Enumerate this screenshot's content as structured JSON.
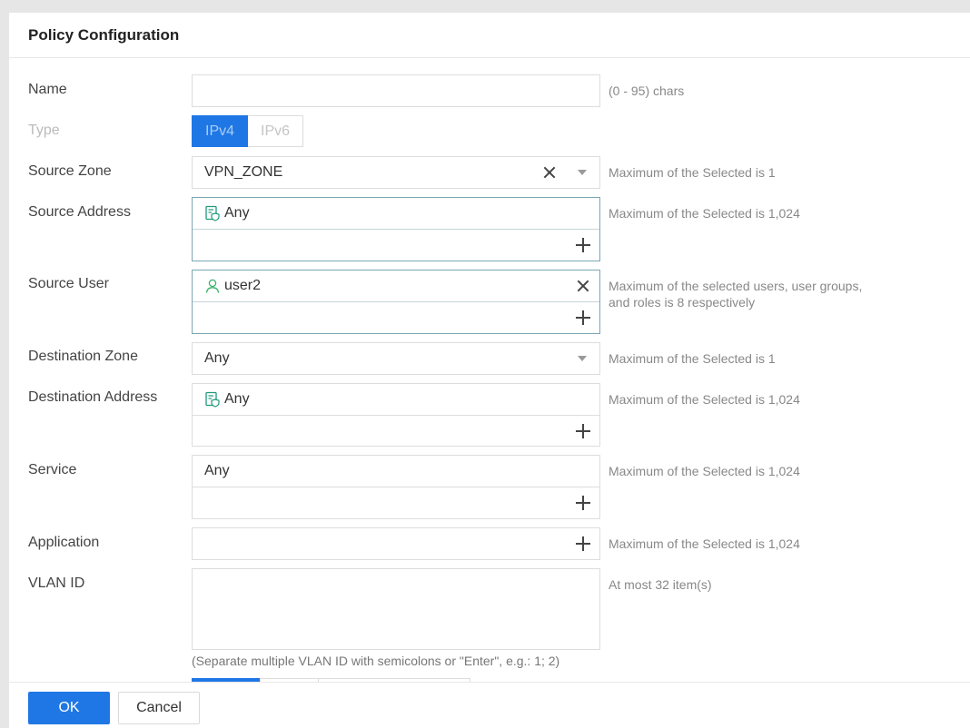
{
  "dialog": {
    "title": "Policy Configuration"
  },
  "name": {
    "label": "Name",
    "value": "",
    "hint": "(0 - 95) chars"
  },
  "type": {
    "label": "Type",
    "options": [
      "IPv4",
      "IPv6"
    ],
    "selected": "IPv4"
  },
  "source_zone": {
    "label": "Source Zone",
    "value": "VPN_ZONE",
    "hint": "Maximum of the Selected is 1"
  },
  "source_address": {
    "label": "Source Address",
    "items": [
      "Any"
    ],
    "hint": "Maximum of the Selected is 1,024"
  },
  "source_user": {
    "label": "Source User",
    "items": [
      "user2"
    ],
    "hint_line1": "Maximum of the selected users, user groups,",
    "hint_line2": "and roles is 8 respectively"
  },
  "destination_zone": {
    "label": "Destination Zone",
    "value": "Any",
    "hint": "Maximum of the Selected is 1"
  },
  "destination_address": {
    "label": "Destination Address",
    "items": [
      "Any"
    ],
    "hint": "Maximum of the Selected is 1,024"
  },
  "service": {
    "label": "Service",
    "items": [
      "Any"
    ],
    "hint": "Maximum of the Selected is 1,024"
  },
  "application": {
    "label": "Application",
    "hint": "Maximum of the Selected is 1,024"
  },
  "vlan": {
    "label": "VLAN ID",
    "value": "",
    "hint": "At most 32 item(s)",
    "note": "(Separate multiple VLAN ID with semicolons or \"Enter\", e.g.: 1; 2)"
  },
  "footer": {
    "ok_label": "OK",
    "cancel_label": "Cancel"
  },
  "colors": {
    "accent": "#1f77e5",
    "address_icon": "#1f9a7a",
    "user_icon": "#3bb36a"
  },
  "icons": {
    "address": "address-book-shield-icon",
    "user": "user-icon",
    "add": "plus-icon",
    "clear": "close-icon",
    "dropdown": "caret-down-icon"
  }
}
